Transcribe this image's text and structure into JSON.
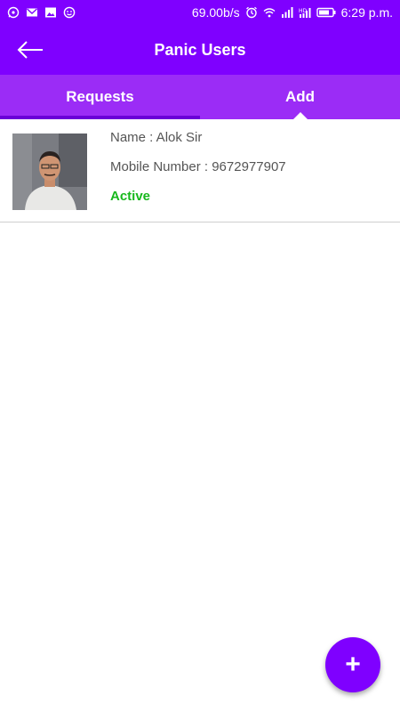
{
  "status_bar": {
    "network_speed": "69.00b/s",
    "time": "6:29 p.m.",
    "left_icons": [
      "whatsapp-icon",
      "gmail-icon",
      "gallery-icon",
      "smiley-icon"
    ],
    "right_icons": [
      "alarm-icon",
      "wifi-icon",
      "signal-icon",
      "hd-signal-icon",
      "battery-icon"
    ]
  },
  "app_bar": {
    "title": "Panic Users",
    "back_icon": "back-arrow-icon"
  },
  "tabs": [
    {
      "label": "Requests",
      "selected": false
    },
    {
      "label": "Add",
      "selected": true
    }
  ],
  "users": [
    {
      "name_line": "Name : Alok Sir",
      "mobile_line": "Mobile Number : 9672977907",
      "status": "Active"
    }
  ],
  "fab": {
    "icon": "plus-icon",
    "label": "+"
  },
  "colors": {
    "primary": "#7f00ff",
    "tab_bar": "#9b2cf6",
    "active_status": "#18b81d"
  }
}
